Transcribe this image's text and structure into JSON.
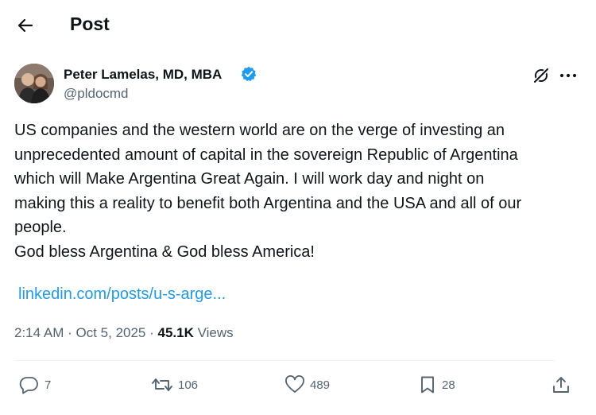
{
  "header": {
    "title": "Post"
  },
  "author": {
    "name": "Peter Lamelas, MD, MBA",
    "handle": "@pldocmd"
  },
  "post": {
    "lines": [
      "US companies and the western world are on the verge of investing an",
      "unprecedented amount of capital in the sovereign Republic of Argentina",
      "which will Make Argentina Great Again. I will work day and night on",
      "making this a reality to benefit both Argentina and the USA and all of our",
      "people.",
      "God bless Argentina & God bless America!"
    ],
    "link": "linkedin.com/posts/u-s-arge..."
  },
  "meta": {
    "time": "2:14 AM",
    "date": "Oct 5, 2025",
    "views_count": "45.1K",
    "views_label": "Views"
  },
  "actions": {
    "replies": "7",
    "reposts": "106",
    "likes": "489",
    "bookmarks": "28"
  },
  "colors": {
    "accent": "#1d9bf0",
    "text": "#0f1419",
    "muted": "#536471"
  }
}
